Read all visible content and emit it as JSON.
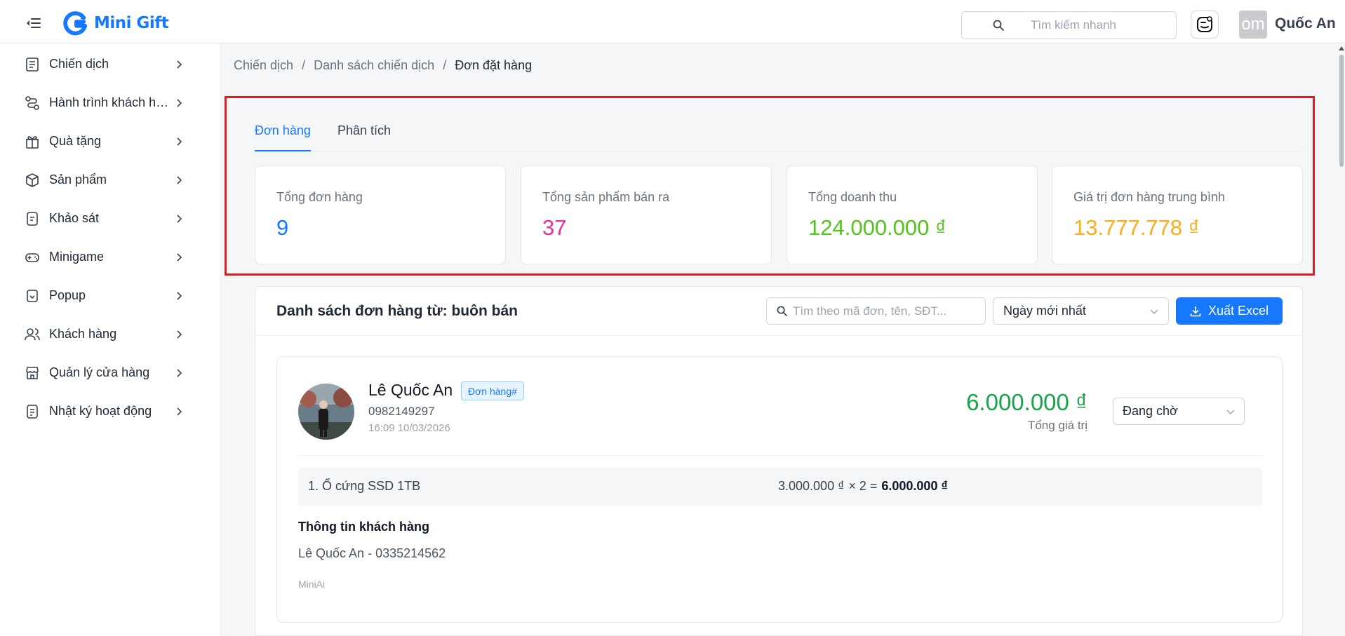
{
  "header": {
    "app_name": "Mini Gift",
    "search_placeholder": "Tìm kiếm nhanh",
    "user_avatar_text": "om",
    "user_name": "Quốc An"
  },
  "sidebar": {
    "items": [
      {
        "label": "Chiến dịch",
        "icon": "campaign-icon"
      },
      {
        "label": "Hành trình khách hàng",
        "icon": "journey-icon"
      },
      {
        "label": "Quà tặng",
        "icon": "gift-icon"
      },
      {
        "label": "Sản phẩm",
        "icon": "box-icon"
      },
      {
        "label": "Khảo sát",
        "icon": "survey-icon"
      },
      {
        "label": "Minigame",
        "icon": "gamepad-icon"
      },
      {
        "label": "Popup",
        "icon": "popup-icon"
      },
      {
        "label": "Khách hàng",
        "icon": "users-icon"
      },
      {
        "label": "Quản lý cửa hàng",
        "icon": "store-icon"
      },
      {
        "label": "Nhật ký hoạt động",
        "icon": "log-icon"
      }
    ]
  },
  "breadcrumb": {
    "items": [
      "Chiến dịch",
      "Danh sách chiến dịch",
      "Đơn đặt hàng"
    ],
    "separator": "/"
  },
  "tabs": [
    {
      "label": "Đơn hàng",
      "active": true
    },
    {
      "label": "Phân tích",
      "active": false
    }
  ],
  "stats": [
    {
      "label": "Tổng đơn hàng",
      "value": "9",
      "color": "#1677ff"
    },
    {
      "label": "Tổng sản phẩm bán ra",
      "value": "37",
      "color": "#eb2f96"
    },
    {
      "label": "Tổng doanh thu",
      "value": "124.000.000 ₫",
      "color": "#52c41a"
    },
    {
      "label": "Giá trị đơn hàng trung bình",
      "value": "13.777.778 ₫",
      "color": "#faad14"
    }
  ],
  "orders": {
    "title": "Danh sách đơn hàng từ: buôn bán",
    "search_placeholder": "Tìm theo mã đơn, tên, SĐT...",
    "sort_value": "Ngày mới nhất",
    "export_label": "Xuất Excel",
    "list": [
      {
        "customer_name": "Lê Quốc An",
        "badge": "Đơn hàng#",
        "phone": "0982149297",
        "time": "16:09 10/03/2026",
        "total": "6.000.000 ₫",
        "total_label": "Tổng giá trị",
        "status": "Đang chờ",
        "item_name": "1. Ổ cứng SSD 1TB",
        "item_price": "3.000.000 ₫",
        "item_qty": "× 2 =",
        "item_subtotal": "6.000.000 ₫",
        "info_title": "Thông tin khách hàng",
        "info_line": "Lê Quốc An - 0335214562",
        "source": "MiniAi"
      }
    ]
  },
  "colors": {
    "accent": "#1677ff",
    "highlight_border": "#d61f26",
    "total_green": "#16a34a"
  }
}
